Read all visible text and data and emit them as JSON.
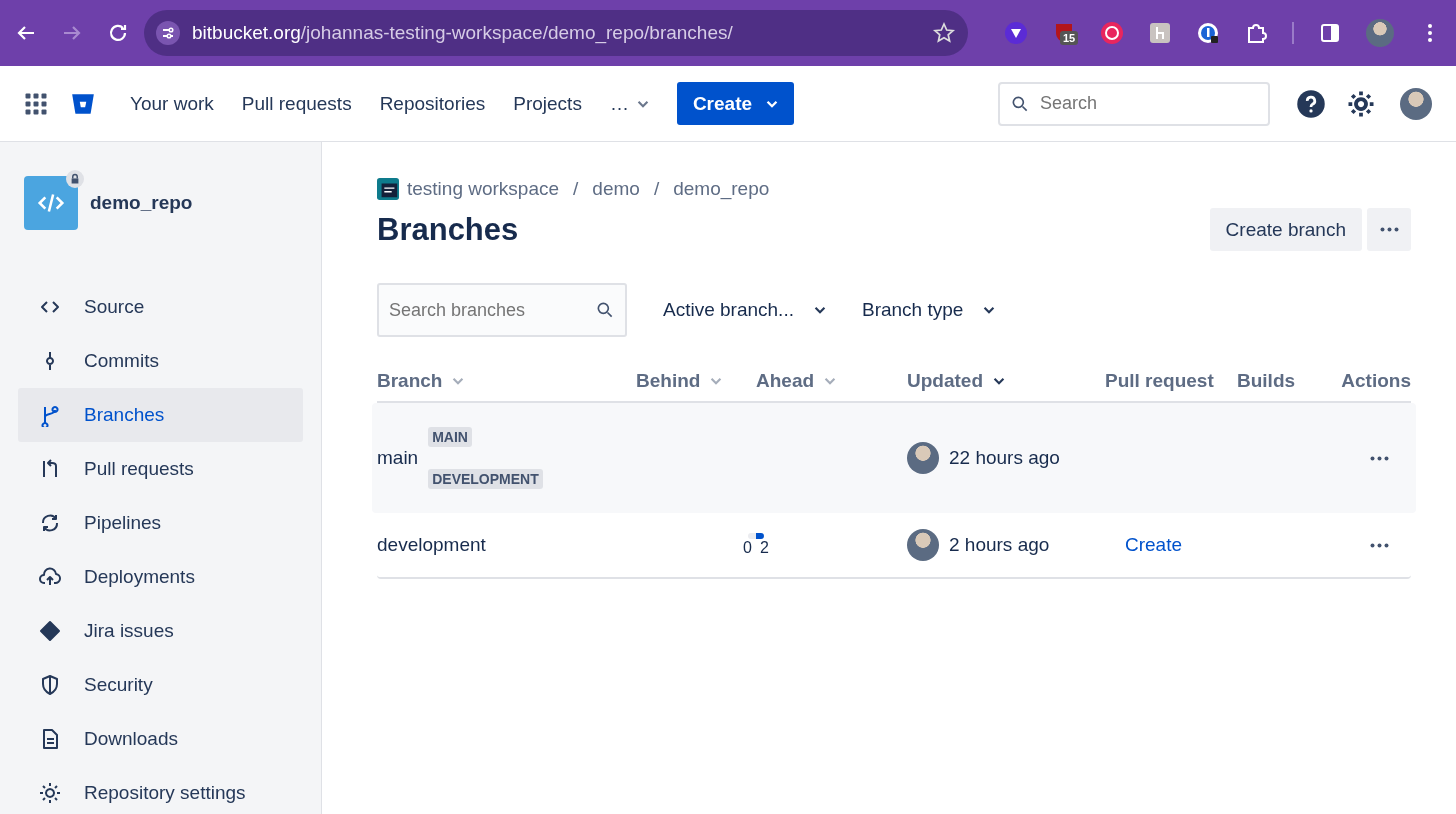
{
  "browser": {
    "url_host": "bitbucket.org",
    "url_path": "/johannas-testing-workspace/demo_repo/branches/",
    "extension_badge": "15"
  },
  "nav": {
    "items": [
      "Your work",
      "Pull requests",
      "Repositories",
      "Projects"
    ],
    "more": "…",
    "create": "Create",
    "search_placeholder": "Search"
  },
  "sidebar": {
    "repo": "demo_repo",
    "items": [
      {
        "label": "Source",
        "selected": false
      },
      {
        "label": "Commits",
        "selected": false
      },
      {
        "label": "Branches",
        "selected": true
      },
      {
        "label": "Pull requests",
        "selected": false
      },
      {
        "label": "Pipelines",
        "selected": false
      },
      {
        "label": "Deployments",
        "selected": false
      },
      {
        "label": "Jira issues",
        "selected": false
      },
      {
        "label": "Security",
        "selected": false
      },
      {
        "label": "Downloads",
        "selected": false
      },
      {
        "label": "Repository settings",
        "selected": false
      }
    ]
  },
  "breadcrumbs": [
    "testing workspace",
    "demo",
    "demo_repo"
  ],
  "breadcrumb_separator": "/",
  "title": "Branches",
  "create_branch": "Create branch",
  "search": {
    "placeholder": "Search branches"
  },
  "filters": [
    "Active branch...",
    "Branch type"
  ],
  "table": {
    "columns": [
      {
        "label": "Branch",
        "sortable": true,
        "sorted": false
      },
      {
        "label": "Behind",
        "sortable": true,
        "sorted": false
      },
      {
        "label": "Ahead",
        "sortable": true,
        "sorted": false
      },
      {
        "label": "Updated",
        "sortable": true,
        "sorted": true
      },
      {
        "label": "Pull request",
        "sortable": false
      },
      {
        "label": "Builds",
        "sortable": false
      },
      {
        "label": "Actions",
        "sortable": false
      }
    ],
    "rows": [
      {
        "branch": "main",
        "labels": [
          "MAIN",
          "DEVELOPMENT"
        ],
        "updated": "22 hours ago",
        "hovered": true
      },
      {
        "branch": "development",
        "labels": [],
        "behind": "0",
        "ahead": "2",
        "updated": "2 hours ago",
        "pull_request": "Create",
        "hovered": false
      }
    ]
  }
}
